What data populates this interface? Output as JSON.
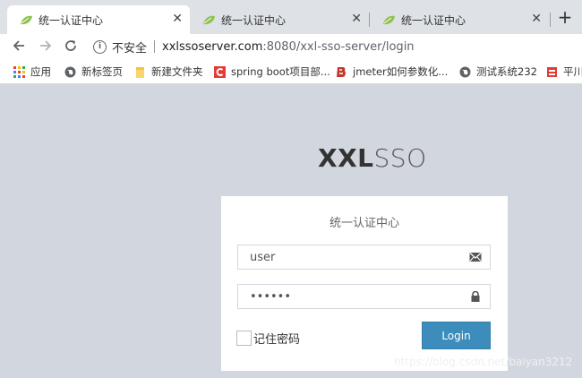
{
  "tabs": [
    {
      "title": "统一认证中心",
      "active": true
    },
    {
      "title": "统一认证中心",
      "active": false
    },
    {
      "title": "统一认证中心",
      "active": false
    }
  ],
  "address_bar": {
    "security_label": "不安全",
    "url_host": "xxlssoserver.com",
    "url_rest": ":8080/xxl-sso-server/login"
  },
  "bookmarks": [
    {
      "label": "应用",
      "icon": "apps-grid-icon"
    },
    {
      "label": "新标签页",
      "icon": "globe-icon"
    },
    {
      "label": "新建文件夹",
      "icon": "folder-icon"
    },
    {
      "label": "spring boot项目部...",
      "icon": "csdn-c-icon"
    },
    {
      "label": "jmeter如何参数化...",
      "icon": "b-logo-icon"
    },
    {
      "label": "测试系统232",
      "icon": "globe-icon"
    },
    {
      "label": "平川",
      "icon": "red-flag-icon"
    }
  ],
  "logo": {
    "bold": "XXL",
    "light": "SSO"
  },
  "login": {
    "title": "统一认证中心",
    "username_value": "user",
    "password_value": "••••••",
    "remember_label": "记住密码",
    "submit_label": "Login"
  },
  "watermark": "https://blog.csdn.net/baiyan3212",
  "colors": {
    "accent": "#3c8dbc",
    "background": "#d2d6de"
  }
}
